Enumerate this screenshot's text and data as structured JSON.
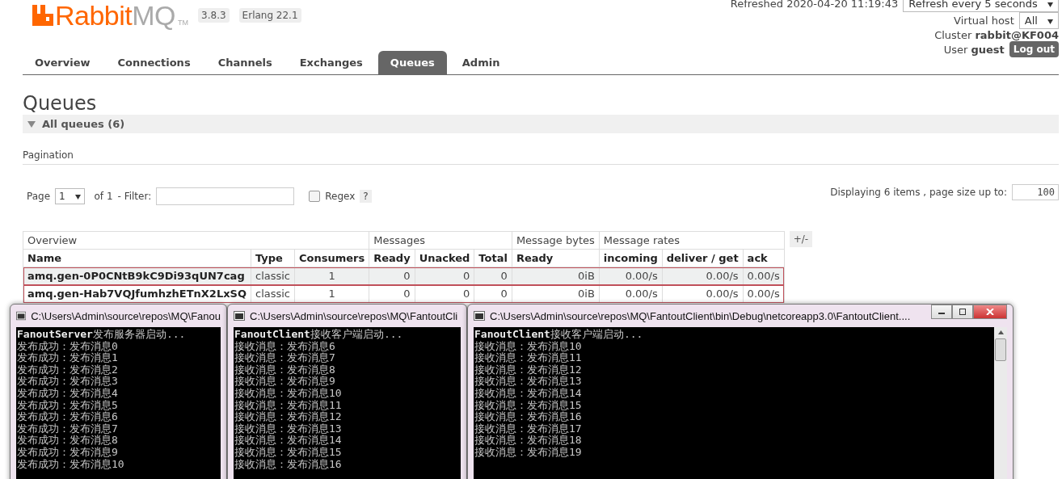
{
  "header": {
    "logo": {
      "brand": "Rabbit",
      "suffix": "MQ",
      "tm": "TM"
    },
    "version": "3.8.3",
    "erlang": "Erlang 22.1",
    "refreshed": "Refreshed 2020-04-20 11:19:43",
    "refresh_select": "Refresh every 5 seconds",
    "virtual_host": {
      "label": "Virtual host",
      "value": "All"
    },
    "cluster": {
      "label": "Cluster",
      "value": "rabbit@KF004"
    },
    "user": {
      "label": "User",
      "value": "guest"
    },
    "logout": "Log out"
  },
  "tabs": [
    {
      "label": "Overview",
      "selected": false
    },
    {
      "label": "Connections",
      "selected": false
    },
    {
      "label": "Channels",
      "selected": false
    },
    {
      "label": "Exchanges",
      "selected": false
    },
    {
      "label": "Queues",
      "selected": true
    },
    {
      "label": "Admin",
      "selected": false
    }
  ],
  "page_title": "Queues",
  "section": {
    "label": "All queues (6)",
    "expanded": true
  },
  "pagination": {
    "label": "Pagination",
    "page_label": "Page",
    "page": "1",
    "of": "of 1",
    "filter_label": "- Filter:",
    "regex": {
      "label": "Regex",
      "checked": false
    },
    "help": "?",
    "displaying": "Displaying 6 items , page size up to:",
    "page_size": "100"
  },
  "table": {
    "groups": [
      "Overview",
      "Messages",
      "Message bytes",
      "Message rates"
    ],
    "columns": [
      "Name",
      "Type",
      "Consumers",
      "Ready",
      "Unacked",
      "Total",
      "Ready",
      "incoming",
      "deliver / get",
      "ack"
    ],
    "rows": [
      {
        "highlighted": true,
        "cells": [
          "amq.gen-0P0CNtB9kC9Di93qUN7cag",
          "classic",
          "1",
          "0",
          "0",
          "0",
          "0iB",
          "0.00/s",
          "0.00/s",
          "0.00/s"
        ]
      },
      {
        "highlighted": true,
        "cells": [
          "amq.gen-Hab7VQJfumhzhETnX2LxSQ",
          "classic",
          "1",
          "0",
          "0",
          "0",
          "0iB",
          "0.00/s",
          "0.00/s",
          "0.00/s"
        ]
      }
    ],
    "toggle": "+/-"
  },
  "consoles": [
    {
      "title": "C:\\Users\\Admin\\source\\repos\\MQ\\Fanou",
      "show_controls": false,
      "scrollbar": false,
      "lines": [
        "**FanoutServer**发布服务器启动...",
        "发布成功：发布消息0",
        "发布成功：发布消息1",
        "发布成功：发布消息2",
        "发布成功：发布消息3",
        "发布成功：发布消息4",
        "发布成功：发布消息5",
        "发布成功：发布消息6",
        "发布成功：发布消息7",
        "发布成功：发布消息8",
        "发布成功：发布消息9",
        "发布成功：发布消息10"
      ]
    },
    {
      "title": "C:\\Users\\Admin\\source\\repos\\MQ\\FantoutCli",
      "show_controls": false,
      "scrollbar": false,
      "lines": [
        "**FanoutClient**接收客户端启动...",
        "接收消息：发布消息6",
        "接收消息：发布消息7",
        "接收消息：发布消息8",
        "接收消息：发布消息9",
        "接收消息：发布消息10",
        "接收消息：发布消息11",
        "接收消息：发布消息12",
        "接收消息：发布消息13",
        "接收消息：发布消息14",
        "接收消息：发布消息15",
        "接收消息：发布消息16"
      ]
    },
    {
      "title": "C:\\Users\\Admin\\source\\repos\\MQ\\FantoutClient\\bin\\Debug\\netcoreapp3.0\\FantoutClient....",
      "show_controls": true,
      "scrollbar": true,
      "lines": [
        "**FanoutClient**接收客户端启动...",
        "接收消息：发布消息10",
        "接收消息：发布消息11",
        "接收消息：发布消息12",
        "接收消息：发布消息13",
        "接收消息：发布消息14",
        "接收消息：发布消息15",
        "接收消息：发布消息16",
        "接收消息：发布消息17",
        "接收消息：发布消息18",
        "接收消息：发布消息19"
      ]
    }
  ]
}
